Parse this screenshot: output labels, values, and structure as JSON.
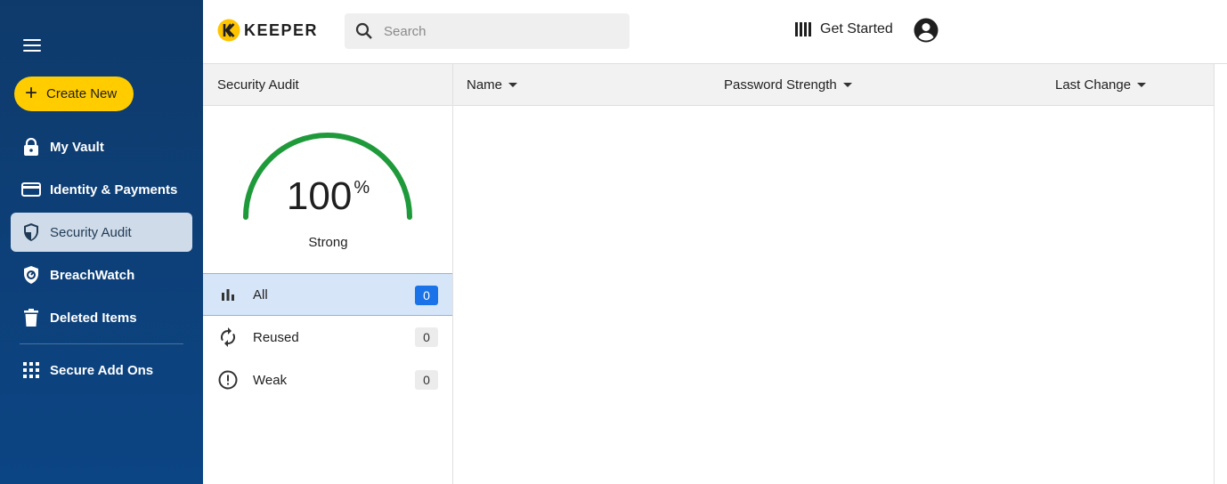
{
  "sidebar": {
    "create_label": "Create New",
    "items": [
      {
        "label": "My Vault",
        "icon": "lock-icon"
      },
      {
        "label": "Identity & Payments",
        "icon": "credit-card-icon"
      },
      {
        "label": "Security Audit",
        "icon": "shield-icon",
        "active": true
      },
      {
        "label": "BreachWatch",
        "icon": "breachwatch-icon"
      },
      {
        "label": "Deleted Items",
        "icon": "trash-icon"
      },
      {
        "label": "Secure Add Ons",
        "icon": "grid-icon"
      }
    ]
  },
  "topbar": {
    "logo_text": "KEEPER",
    "search_placeholder": "Search",
    "get_started_label": "Get Started"
  },
  "audit": {
    "header": "Security Audit",
    "score": "100",
    "score_unit": "%",
    "score_fraction": 1.0,
    "strength_label": "Strong",
    "filters": [
      {
        "label": "All",
        "count": "0",
        "icon": "bar-chart-icon",
        "active": true
      },
      {
        "label": "Reused",
        "count": "0",
        "icon": "sync-icon"
      },
      {
        "label": "Weak",
        "count": "0",
        "icon": "alert-circle-icon"
      }
    ]
  },
  "table": {
    "columns": [
      "Name",
      "Password Strength",
      "Last Change"
    ]
  },
  "colors": {
    "sidebar_bg": "#0e3a6b",
    "accent_yellow": "#ffcc00",
    "gauge_green": "#1e9a3a",
    "active_blue": "#1a73e8"
  }
}
